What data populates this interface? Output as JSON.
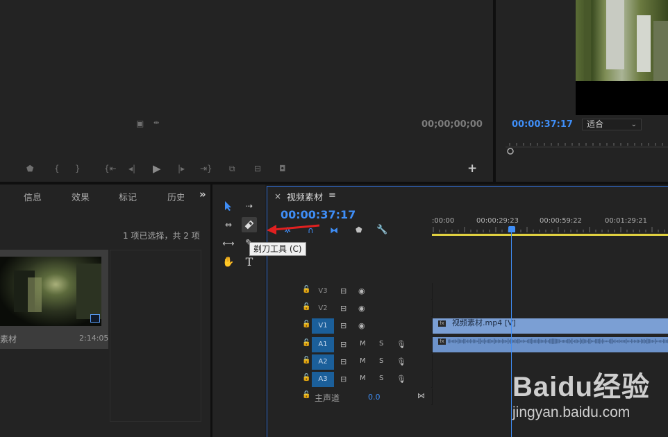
{
  "source_monitor": {
    "timecode": "00;00;00;00",
    "add_symbol": "+"
  },
  "program_monitor": {
    "timecode": "00:00:37:17",
    "fit_label": "适合"
  },
  "project_panel": {
    "tabs": [
      "信息",
      "效果",
      "标记",
      "历史"
    ],
    "overflow_symbol": "»",
    "selection_status": "1 项已选择，共 2 项",
    "clip_name": "素材",
    "clip_duration": "2:14:05"
  },
  "tools": {
    "tooltip": "剃刀工具 (C)",
    "type_tool_glyph": "T"
  },
  "timeline": {
    "close_symbol": "×",
    "sequence_name": "视频素材",
    "menu_symbol": "≡",
    "timecode": "00:00:37:17",
    "ruler_labels": [
      ":00:00",
      "00:00:29:23",
      "00:00:59:22",
      "00:01:29:21"
    ],
    "tracks": [
      {
        "label": "V3",
        "type": "video",
        "active": false
      },
      {
        "label": "V2",
        "type": "video",
        "active": false
      },
      {
        "label": "V1",
        "type": "video",
        "active": true
      },
      {
        "label": "A1",
        "type": "audio",
        "active": true
      },
      {
        "label": "A2",
        "type": "audio",
        "active": true
      },
      {
        "label": "A3",
        "type": "audio",
        "active": true
      }
    ],
    "mute_label": "M",
    "solo_label": "S",
    "video_clip_name": "视频素材.mp4 [V]",
    "master_label": "主声道",
    "master_value": "0.0",
    "fx_badge": "fx"
  },
  "watermark": {
    "main": "Baidu经验",
    "sub": "jingyan.baidu.com"
  },
  "colors": {
    "accent_blue": "#3f8ef7",
    "clip_video": "#7b9fd4",
    "clip_audio": "#6d93cb",
    "track_active": "#1b5f9a",
    "work_area": "#e0d040",
    "arrow_red": "#e02020"
  }
}
